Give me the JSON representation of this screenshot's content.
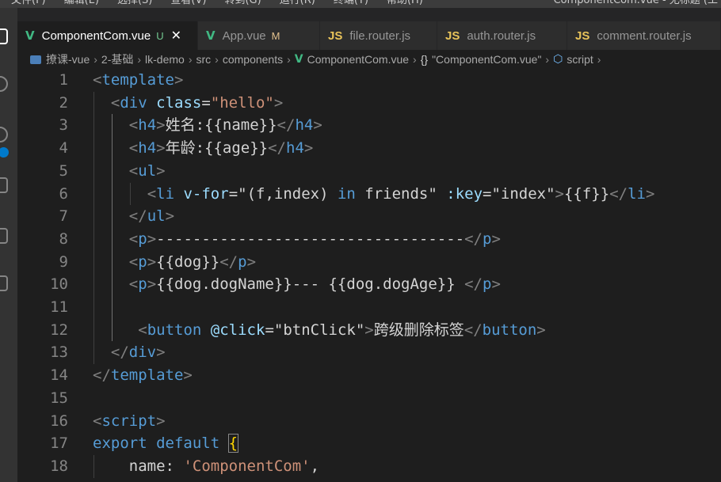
{
  "menu": {
    "items": [
      "文件(F)",
      "编辑(E)",
      "选择(S)",
      "查看(V)",
      "转到(G)",
      "运行(R)",
      "终端(T)",
      "帮助(H)"
    ],
    "window_title": "ComponentCom.vue - 无标题 (工"
  },
  "tabs": [
    {
      "label": "ComponentCom.vue",
      "icon": "vue-icon",
      "status": "U",
      "active": true
    },
    {
      "label": "App.vue",
      "icon": "vue-icon",
      "status": "M",
      "active": false
    },
    {
      "label": "file.router.js",
      "icon": "js-icon",
      "status": "",
      "active": false
    },
    {
      "label": "auth.router.js",
      "icon": "js-icon",
      "status": "",
      "active": false
    },
    {
      "label": "comment.router.js",
      "icon": "js-icon",
      "status": "",
      "active": false
    }
  ],
  "icons": {
    "vue": "V",
    "js": "JS",
    "close": "✕"
  },
  "breadcrumb": [
    "撩课-vue",
    "2-基础",
    "lk-demo",
    "src",
    "components",
    "ComponentCom.vue",
    "\"ComponentCom.vue\"",
    "script"
  ],
  "breadcrumb_symbols": {
    "object": "{}",
    "script": "⬡"
  },
  "colors": {
    "background": "#1e1e1e",
    "tag": "#569cd6",
    "attribute": "#9cdcfe",
    "string": "#ce9178",
    "text": "#d4d4d4",
    "punctuation": "#808080",
    "line_number": "#858585",
    "vue_green": "#41b883",
    "js_yellow": "#e8c35a"
  },
  "code_lines": [
    {
      "n": "1",
      "indent": 0,
      "tokens": [
        [
          "p",
          "<"
        ],
        [
          "t",
          "template"
        ],
        [
          "p",
          ">"
        ]
      ]
    },
    {
      "n": "2",
      "indent": 1,
      "tokens": [
        [
          "p",
          "<"
        ],
        [
          "t",
          "div"
        ],
        [
          "x",
          " "
        ],
        [
          "a",
          "class"
        ],
        [
          "x",
          "="
        ],
        [
          "s",
          "\"hello\""
        ],
        [
          "p",
          ">"
        ]
      ]
    },
    {
      "n": "3",
      "indent": 2,
      "tokens": [
        [
          "p",
          "<"
        ],
        [
          "t",
          "h4"
        ],
        [
          "p",
          ">"
        ],
        [
          "x",
          "姓名:{{name}}"
        ],
        [
          "p",
          "</"
        ],
        [
          "t",
          "h4"
        ],
        [
          "p",
          ">"
        ]
      ]
    },
    {
      "n": "4",
      "indent": 2,
      "tokens": [
        [
          "p",
          "<"
        ],
        [
          "t",
          "h4"
        ],
        [
          "p",
          ">"
        ],
        [
          "x",
          "年龄:{{age}}"
        ],
        [
          "p",
          "</"
        ],
        [
          "t",
          "h4"
        ],
        [
          "p",
          ">"
        ]
      ]
    },
    {
      "n": "5",
      "indent": 2,
      "tokens": [
        [
          "p",
          "<"
        ],
        [
          "t",
          "ul"
        ],
        [
          "p",
          ">"
        ]
      ]
    },
    {
      "n": "6",
      "indent": 3,
      "tokens": [
        [
          "p",
          "<"
        ],
        [
          "t",
          "li"
        ],
        [
          "x",
          " "
        ],
        [
          "a",
          "v-for"
        ],
        [
          "x",
          "=\"(f,index) "
        ],
        [
          "t",
          "in"
        ],
        [
          "x",
          " friends\" "
        ],
        [
          "a",
          ":key"
        ],
        [
          "x",
          "=\"index\""
        ],
        [
          "p",
          ">"
        ],
        [
          "x",
          "{{f}}"
        ],
        [
          "p",
          "</"
        ],
        [
          "t",
          "li"
        ],
        [
          "p",
          ">"
        ]
      ]
    },
    {
      "n": "7",
      "indent": 2,
      "tokens": [
        [
          "p",
          "</"
        ],
        [
          "t",
          "ul"
        ],
        [
          "p",
          ">"
        ]
      ]
    },
    {
      "n": "8",
      "indent": 2,
      "tokens": [
        [
          "p",
          "<"
        ],
        [
          "t",
          "p"
        ],
        [
          "p",
          ">"
        ],
        [
          "x",
          "----------------------------------"
        ],
        [
          "p",
          "</"
        ],
        [
          "t",
          "p"
        ],
        [
          "p",
          ">"
        ]
      ]
    },
    {
      "n": "9",
      "indent": 2,
      "tokens": [
        [
          "p",
          "<"
        ],
        [
          "t",
          "p"
        ],
        [
          "p",
          ">"
        ],
        [
          "x",
          "{{dog}}"
        ],
        [
          "p",
          "</"
        ],
        [
          "t",
          "p"
        ],
        [
          "p",
          ">"
        ]
      ]
    },
    {
      "n": "10",
      "indent": 2,
      "tokens": [
        [
          "p",
          "<"
        ],
        [
          "t",
          "p"
        ],
        [
          "p",
          ">"
        ],
        [
          "x",
          "{{dog.dogName}}--- {{dog.dogAge}} "
        ],
        [
          "p",
          "</"
        ],
        [
          "t",
          "p"
        ],
        [
          "p",
          ">"
        ]
      ]
    },
    {
      "n": "11",
      "indent": 0,
      "tokens": []
    },
    {
      "n": "12",
      "indent": 2.5,
      "tokens": [
        [
          "p",
          "<"
        ],
        [
          "t",
          "button"
        ],
        [
          "x",
          " "
        ],
        [
          "a",
          "@click"
        ],
        [
          "x",
          "=\"btnClick\""
        ],
        [
          "p",
          ">"
        ],
        [
          "x",
          "跨级删除标签"
        ],
        [
          "p",
          "</"
        ],
        [
          "t",
          "button"
        ],
        [
          "p",
          ">"
        ]
      ]
    },
    {
      "n": "13",
      "indent": 1,
      "tokens": [
        [
          "p",
          "</"
        ],
        [
          "t",
          "div"
        ],
        [
          "p",
          ">"
        ]
      ]
    },
    {
      "n": "14",
      "indent": 0,
      "tokens": [
        [
          "p",
          "</"
        ],
        [
          "t",
          "template"
        ],
        [
          "p",
          ">"
        ]
      ]
    },
    {
      "n": "15",
      "indent": 0,
      "tokens": []
    },
    {
      "n": "16",
      "indent": 0,
      "tokens": [
        [
          "p",
          "<"
        ],
        [
          "t",
          "script"
        ],
        [
          "p",
          ">"
        ]
      ]
    },
    {
      "n": "17",
      "indent": 0,
      "tokens": [
        [
          "k",
          "export"
        ],
        [
          "x",
          " "
        ],
        [
          "k",
          "default"
        ],
        [
          "x",
          " "
        ],
        [
          "b",
          "{"
        ]
      ]
    },
    {
      "n": "18",
      "indent": 2,
      "tokens": [
        [
          "x",
          "name: "
        ],
        [
          "s",
          "'ComponentCom'"
        ],
        [
          "x",
          ","
        ]
      ]
    }
  ]
}
